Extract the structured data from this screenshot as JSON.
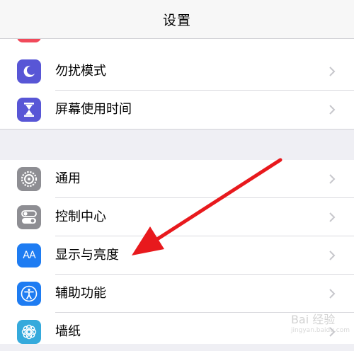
{
  "navbar": {
    "title": "设置"
  },
  "group1": {
    "items": [
      {
        "label": "勿扰模式",
        "icon": "moon-icon",
        "color": "#5856d6"
      },
      {
        "label": "屏幕使用时间",
        "icon": "hourglass-icon",
        "color": "#5856d6"
      }
    ]
  },
  "group2": {
    "items": [
      {
        "label": "通用",
        "icon": "gear-icon",
        "color": "#8e8e93"
      },
      {
        "label": "控制中心",
        "icon": "toggles-icon",
        "color": "#8e8e93"
      },
      {
        "label": "显示与亮度",
        "icon": "aa-icon",
        "color": "#1e7cf2",
        "icon_text": "AA"
      },
      {
        "label": "辅助功能",
        "icon": "accessibility-icon",
        "color": "#1e7cf2"
      },
      {
        "label": "墙纸",
        "icon": "flower-icon",
        "color": "#35aadc"
      }
    ]
  },
  "annotation": {
    "arrow_color": "#e8191d"
  },
  "watermark": {
    "text": "Bai 经验",
    "sub": "jingyan.baidu.com"
  }
}
